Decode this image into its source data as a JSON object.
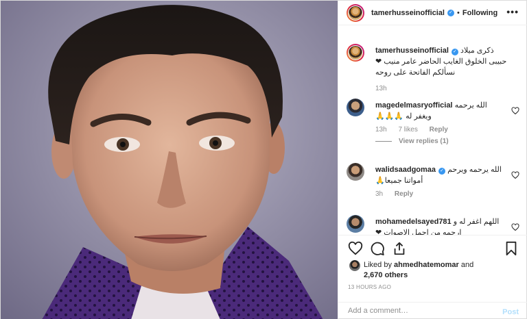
{
  "header": {
    "username": "tamerhusseinofficial",
    "separator": "•",
    "follow_status": "Following",
    "more_label": "•••"
  },
  "caption": {
    "username": "tamerhusseinofficial",
    "text": "ذكرى ميلاد حبيبى الخلوق الغايب الحاضر عامر منيب ❤نسألكم الفاتحة على روحه",
    "time": "13h"
  },
  "comments": [
    {
      "username": "magedelmasryofficial",
      "text": "الله يرحمه ويغفر له 🙏🙏🙏",
      "time": "13h",
      "likes": "7 likes",
      "reply": "Reply",
      "view_replies": "View replies (1)"
    },
    {
      "username": "walidsaadgomaa",
      "text": "الله يرحمه ويرحم أمواتنا جميعا🙏",
      "time": "3h",
      "reply": "Reply"
    },
    {
      "username": "mohamedelsayed781",
      "text": "اللهم اغفر له و ارحمه من اجمل الاصوات ❤"
    }
  ],
  "likes": {
    "prefix": "Liked by",
    "user": "ahmedhatemomar",
    "and": "and",
    "others": "2,670 others"
  },
  "time_ago": "13 HOURS AGO",
  "add_comment": {
    "placeholder": "Add a comment…",
    "post_label": "Post"
  },
  "icons": {
    "verified": "verified-badge-icon",
    "heart": "heart-icon",
    "comment": "comment-icon",
    "share": "share-icon",
    "bookmark": "bookmark-icon",
    "more": "more-options-icon"
  },
  "colors": {
    "verified_blue": "#3897f0",
    "post_button_disabled": "#b2dffc",
    "muted_text": "#8e8e8e",
    "text": "#262626"
  }
}
